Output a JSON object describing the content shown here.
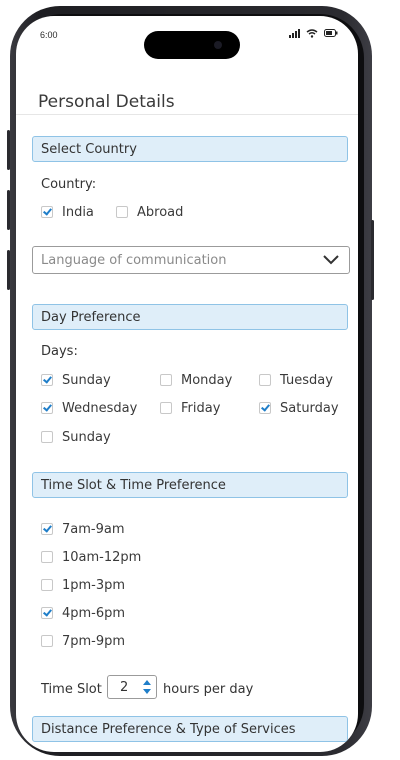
{
  "status_bar": {
    "time": "6:00",
    "icons": [
      "signal-icon",
      "wifi-icon",
      "battery-icon"
    ]
  },
  "header": {
    "title": "Personal Details"
  },
  "country_section": {
    "title": "Select Country",
    "label": "Country:",
    "options": [
      {
        "label": "India",
        "checked": true
      },
      {
        "label": "Abroad",
        "checked": false
      }
    ]
  },
  "language_select": {
    "placeholder": "Language of communication"
  },
  "day_section": {
    "title": "Day Preference",
    "label": "Days:",
    "options": [
      {
        "label": "Sunday",
        "checked": true
      },
      {
        "label": "Monday",
        "checked": false
      },
      {
        "label": "Tuesday",
        "checked": false
      },
      {
        "label": "Wednesday",
        "checked": true
      },
      {
        "label": "Friday",
        "checked": false
      },
      {
        "label": "Saturday",
        "checked": true
      },
      {
        "label": "Sunday",
        "checked": false
      }
    ]
  },
  "time_section": {
    "title": "Time Slot & Time Preference",
    "options": [
      {
        "label": "7am-9am",
        "checked": true
      },
      {
        "label": "10am-12pm",
        "checked": false
      },
      {
        "label": "1pm-3pm",
        "checked": false
      },
      {
        "label": "4pm-6pm",
        "checked": true
      },
      {
        "label": "7pm-9pm",
        "checked": false
      }
    ],
    "slot_label": "Time Slot",
    "slot_value": "2",
    "slot_suffix": "hours per day"
  },
  "distance_section": {
    "title": "Distance Preference & Type of Services"
  },
  "colors": {
    "accent": "#1f7ec9",
    "section_bg": "#dfeef9",
    "section_border": "#8fc3e6"
  }
}
